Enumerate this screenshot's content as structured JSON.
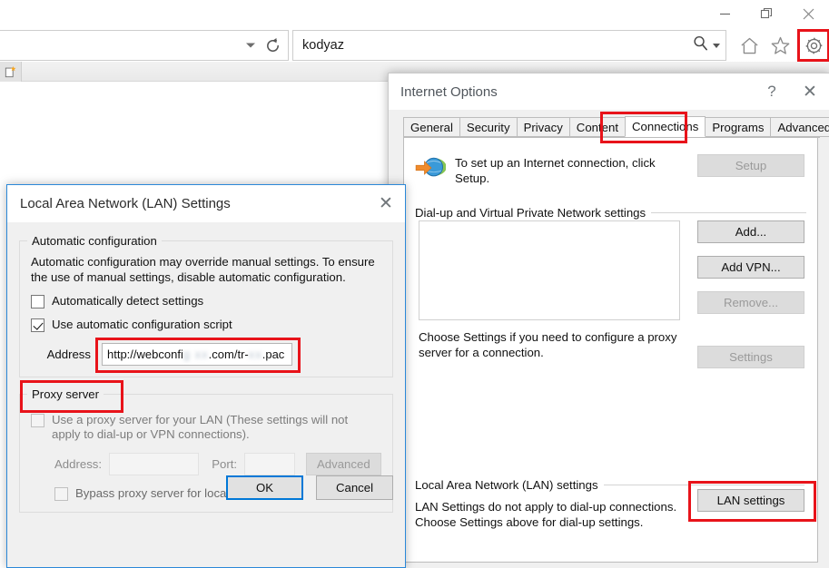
{
  "browser": {
    "window_controls": [
      {
        "name": "minimize",
        "glyph": "minimize-icon"
      },
      {
        "name": "restore",
        "glyph": "restore-icon"
      },
      {
        "name": "close",
        "glyph": "close-icon"
      }
    ],
    "address_bar": {
      "value": "",
      "placeholder": ""
    },
    "reload_label": "reload-icon",
    "search_box": {
      "value": "kodyaz",
      "placeholder": ""
    },
    "tool_icons": [
      {
        "name": "home-icon",
        "label": "Home"
      },
      {
        "name": "favorites-icon",
        "label": "Favorites"
      },
      {
        "name": "gear-icon",
        "label": "Tools"
      }
    ],
    "new_tab_label": "New tab"
  },
  "internet_options": {
    "title": "Internet Options",
    "help_label": "?",
    "close_label": "✕",
    "tabs": [
      {
        "label": "General",
        "active": false
      },
      {
        "label": "Security",
        "active": false
      },
      {
        "label": "Privacy",
        "active": false
      },
      {
        "label": "Content",
        "active": false
      },
      {
        "label": "Connections",
        "active": true
      },
      {
        "label": "Programs",
        "active": false
      },
      {
        "label": "Advanced",
        "active": false
      }
    ],
    "setup": {
      "text": "To set up an Internet connection, click Setup.",
      "button_label": "Setup",
      "button_enabled": false,
      "icon": "globe-arrow-icon"
    },
    "dialup": {
      "legend": "Dial-up and Virtual Private Network settings",
      "list_items": [],
      "buttons": [
        {
          "label": "Add...",
          "enabled": true
        },
        {
          "label": "Add VPN...",
          "enabled": true
        },
        {
          "label": "Remove...",
          "enabled": false
        }
      ],
      "choose_text": "Choose Settings if you need to configure a proxy server for a connection.",
      "settings_button": {
        "label": "Settings",
        "enabled": false
      }
    },
    "lan": {
      "legend": "Local Area Network (LAN) settings",
      "text": "LAN Settings do not apply to dial-up connections. Choose Settings above for dial-up settings.",
      "button_label": "LAN settings",
      "highlighted": true
    }
  },
  "lan_settings": {
    "title": "Local Area Network (LAN) Settings",
    "close_label": "✕",
    "automatic_configuration": {
      "legend": "Automatic configuration",
      "description": "Automatic configuration may override manual settings.  To ensure the use of manual settings, disable automatic configuration.",
      "auto_detect": {
        "label": "Automatically detect settings",
        "checked": false
      },
      "use_script": {
        "label": "Use automatic configuration script",
        "checked": true
      },
      "address_label": "Address",
      "address_value_start": "http://webconfi",
      "address_value_redacted_1": "g  xx",
      "address_value_middle": ".com/tr-",
      "address_value_redacted_2": "xx",
      "address_value_end": ".pac",
      "address_highlighted": true
    },
    "proxy_server": {
      "legend": "Proxy server",
      "legend_highlighted": true,
      "use_proxy": {
        "label": "Use a proxy server for your LAN (These settings will not apply to dial-up or VPN connections).",
        "checked": false,
        "enabled": false
      },
      "address_label": "Address:",
      "address_value": "",
      "port_label": "Port:",
      "port_value": "",
      "advanced_button": {
        "label": "Advanced",
        "enabled": false
      },
      "bypass": {
        "label": "Bypass proxy server for local addresses",
        "checked": false,
        "enabled": false
      }
    },
    "footer": {
      "ok_label": "OK",
      "cancel_label": "Cancel",
      "ok_focused": true
    }
  },
  "colors": {
    "highlight_red": "#e8131a",
    "focus_blue": "#0078d7",
    "dialog_bg": "#f0f0f0",
    "title_text": "#50565c"
  }
}
